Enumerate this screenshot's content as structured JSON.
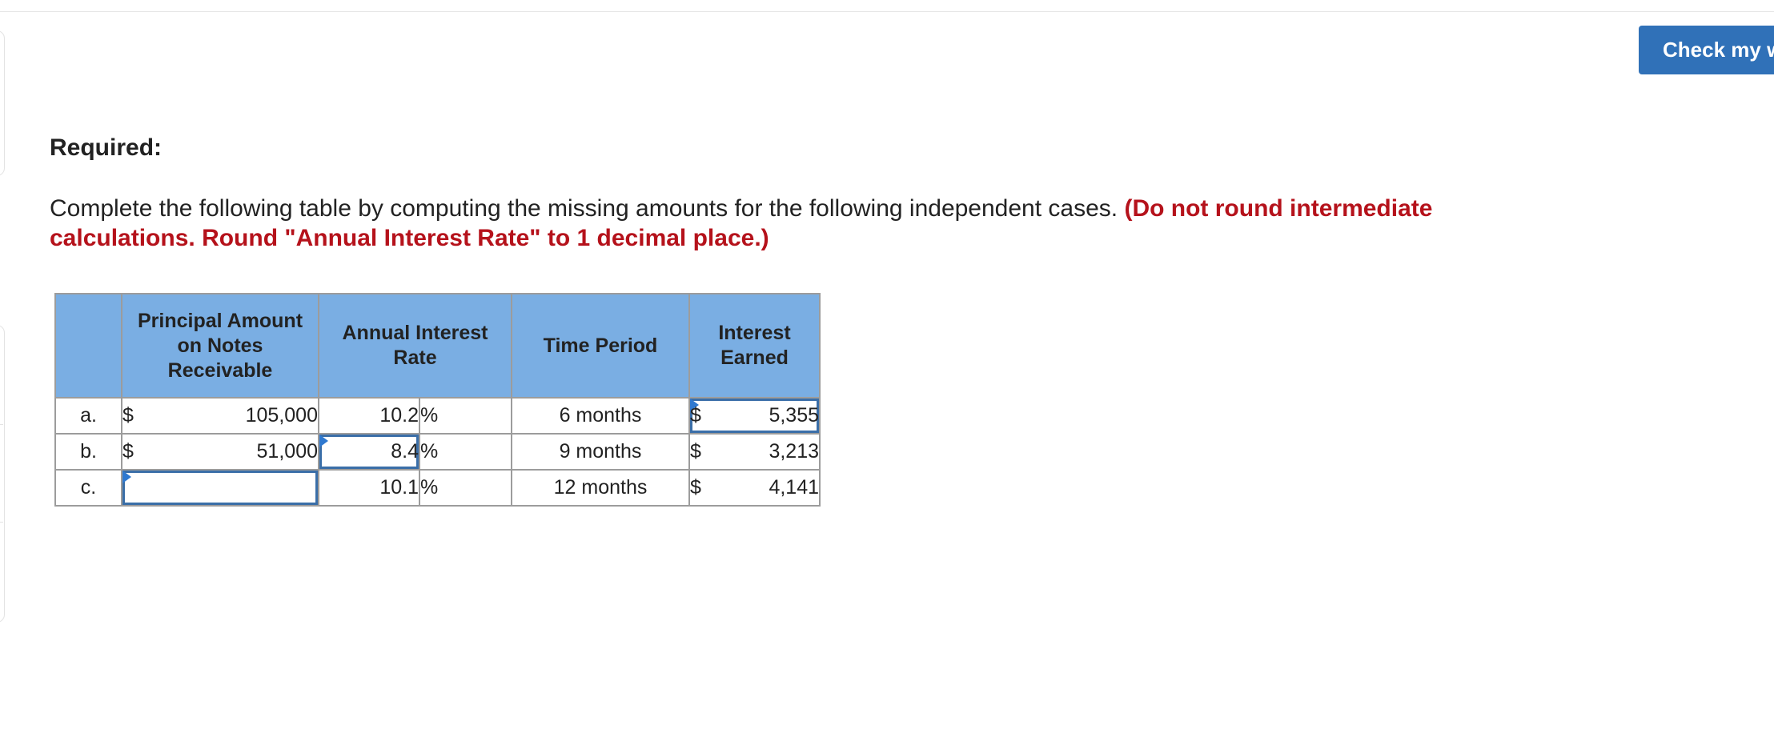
{
  "toolbar": {
    "check_label": "Check my work"
  },
  "question": {
    "heading": "Required:",
    "instructions": "Complete the following table by computing the missing amounts for the following independent cases.",
    "note": "(Do not round intermediate calculations. Round \"Annual Interest Rate\" to 1 decimal place.)"
  },
  "table": {
    "headers": {
      "row_label": "",
      "principal": "Principal Amount on Notes Receivable",
      "rate": "Annual Interest Rate",
      "period": "Time Period",
      "interest": "Interest Earned"
    },
    "rows": [
      {
        "label": "a.",
        "principal_symbol": "$",
        "principal": "105,000",
        "rate": "10.2",
        "rate_unit": "%",
        "period": "6 months",
        "interest_symbol": "$",
        "interest": "5,355"
      },
      {
        "label": "b.",
        "principal_symbol": "$",
        "principal": "51,000",
        "rate": "8.4",
        "rate_unit": "%",
        "period": "9 months",
        "interest_symbol": "$",
        "interest": "3,213"
      },
      {
        "label": "c.",
        "principal_symbol": "",
        "principal": "",
        "rate": "10.1",
        "rate_unit": "%",
        "period": "12 months",
        "interest_symbol": "$",
        "interest": "4,141"
      }
    ]
  }
}
